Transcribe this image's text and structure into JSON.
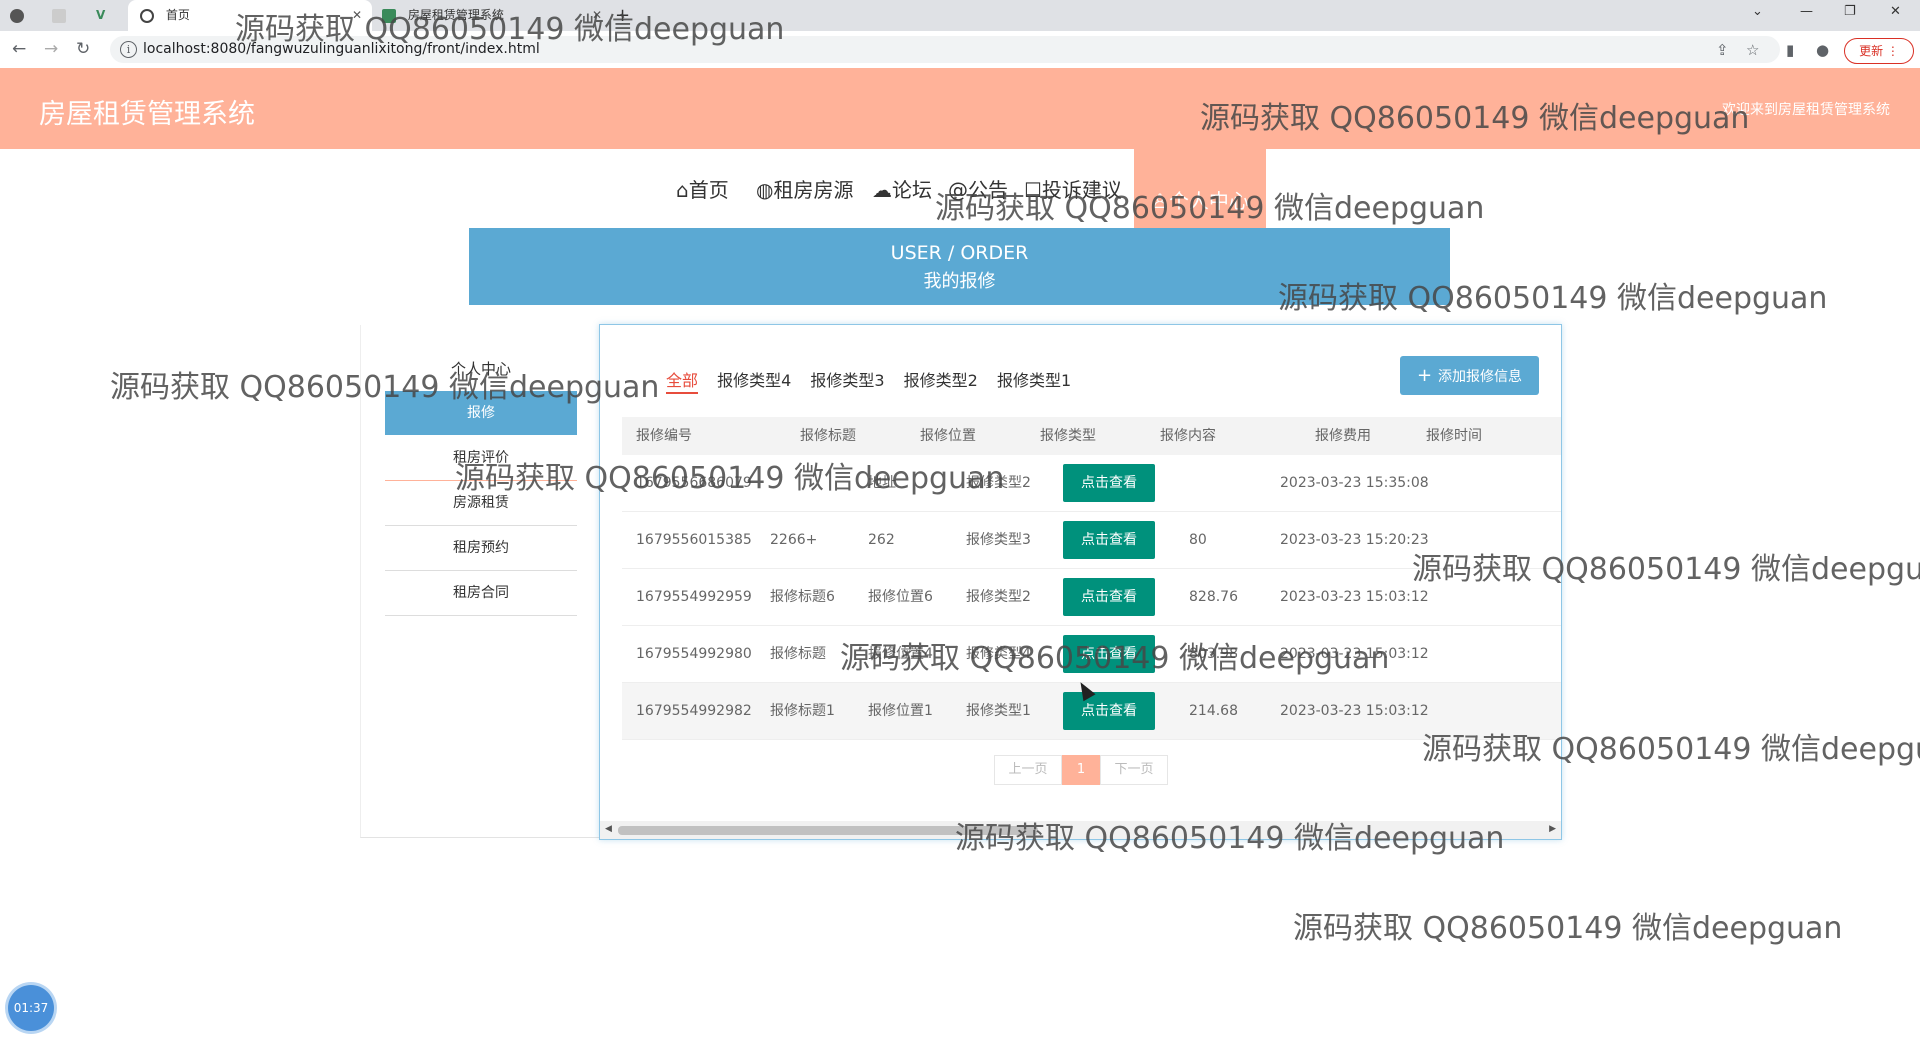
{
  "browser": {
    "tabs": [
      {
        "label": ""
      },
      {
        "label": ""
      },
      {
        "label": ""
      },
      {
        "label": "首页"
      },
      {
        "label": "房屋租赁管理系统"
      }
    ],
    "new_tab": "+",
    "url": "localhost:8080/fangwuzulinguanlixitong/front/index.html",
    "update_label": "更新"
  },
  "header": {
    "title": "房屋租赁管理系统",
    "welcome": "欢迎来到房屋租赁管理系统"
  },
  "nav": {
    "items": [
      {
        "label": "首页",
        "icon": "home-icon"
      },
      {
        "label": "租房房源",
        "icon": "globe-icon"
      },
      {
        "label": "论坛",
        "icon": "cloud-icon"
      },
      {
        "label": "公告",
        "icon": "at-icon"
      },
      {
        "label": "投诉建议",
        "icon": "square-icon"
      },
      {
        "label": "个人中心",
        "icon": "user-icon"
      }
    ]
  },
  "banner": {
    "line1": "USER / ORDER",
    "line2": "我的报修"
  },
  "sidebar": {
    "title": "个人中心",
    "items": [
      {
        "label": "报修"
      },
      {
        "label": "租房评价"
      },
      {
        "label": "房源租赁"
      },
      {
        "label": "租房预约"
      },
      {
        "label": "租房合同"
      }
    ]
  },
  "main": {
    "filters": [
      "全部",
      "报修类型4",
      "报修类型3",
      "报修类型2",
      "报修类型1"
    ],
    "add_button": "添加报修信息",
    "columns": [
      "报修编号",
      "报修标题",
      "报修位置",
      "报修类型",
      "报修内容",
      "报修费用",
      "报修时间"
    ],
    "rows": [
      {
        "id": "1679556686079",
        "title": "",
        "location": "地址",
        "type": "报修类型2",
        "content": "点击查看",
        "fee": "",
        "time": "2023-03-23 15:35:08"
      },
      {
        "id": "1679556015385",
        "title": "2266+",
        "location": "262",
        "type": "报修类型3",
        "content": "点击查看",
        "fee": "80",
        "time": "2023-03-23 15:20:23"
      },
      {
        "id": "1679554992959",
        "title": "报修标题6",
        "location": "报修位置6",
        "type": "报修类型2",
        "content": "点击查看",
        "fee": "828.76",
        "time": "2023-03-23 15:03:12"
      },
      {
        "id": "1679554992980",
        "title": "报修标题",
        "location": "报修位置4",
        "type": "报修类型4",
        "content": "点击查看",
        "fee": "803.98",
        "time": "2023-03-23 15:03:12"
      },
      {
        "id": "1679554992982",
        "title": "报修标题1",
        "location": "报修位置1",
        "type": "报修类型1",
        "content": "点击查看",
        "fee": "214.68",
        "time": "2023-03-23 15:03:12"
      }
    ],
    "pager": {
      "prev": "上一页",
      "current": "1",
      "next": "下一页"
    }
  },
  "watermark": "源码获取 QQ86050149 微信deepguan",
  "timer": "01:37"
}
